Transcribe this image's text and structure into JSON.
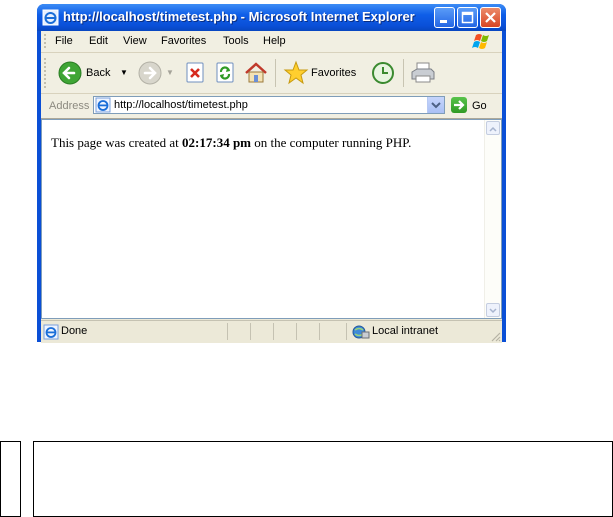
{
  "window": {
    "title": "http://localhost/timetest.php - Microsoft Internet Explorer"
  },
  "menu": {
    "items": [
      "File",
      "Edit",
      "View",
      "Favorites",
      "Tools",
      "Help"
    ]
  },
  "toolbar": {
    "back_label": "Back",
    "favorites_label": "Favorites"
  },
  "address": {
    "label": "Address",
    "url": "http://localhost/timetest.php",
    "go_label": "Go"
  },
  "page": {
    "text_before": "This page was created at ",
    "time": "02:17:34 pm",
    "text_after": " on the computer running PHP."
  },
  "status": {
    "left": "Done",
    "zone": "Local intranet"
  },
  "colors": {
    "titlebar": "#0a50d8",
    "chrome": "#ece9d8",
    "address_border": "#7f9db9"
  },
  "icons": [
    "ie-icon",
    "minimize-icon",
    "maximize-icon",
    "close-icon",
    "windows-logo-icon",
    "back-arrow-icon",
    "forward-arrow-icon",
    "stop-icon",
    "refresh-icon",
    "home-icon",
    "favorites-star-icon",
    "history-icon",
    "print-icon",
    "go-arrow-icon",
    "intranet-icon"
  ]
}
